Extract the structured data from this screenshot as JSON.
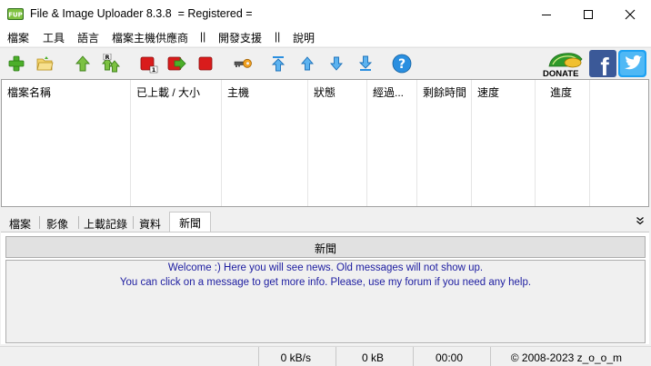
{
  "window": {
    "title": "File & Image Uploader 8.3.8  = Registered ="
  },
  "menu": {
    "items": [
      "檔案",
      "工具",
      "語言",
      "檔案主機供應商",
      "||",
      "開發支援",
      "||",
      "說明"
    ]
  },
  "toolbar": {
    "buttons": [
      "add-icon",
      "open-folder-icon",
      "upload-icon",
      "resume-upload-icon",
      "stop-icon",
      "transfer-icon",
      "stop-all-icon",
      "key-icon",
      "move-top-icon",
      "move-up-icon",
      "move-down-icon",
      "move-bottom-icon",
      "help-icon"
    ],
    "donate_label": "DONATE"
  },
  "list": {
    "columns": [
      "檔案名稱",
      "已上載 / 大小",
      "主機",
      "狀態",
      "經過...",
      "剩餘時間",
      "速度",
      "進度"
    ]
  },
  "tabs": {
    "items": [
      "檔案",
      "影像",
      "上載記錄",
      "資料",
      "新聞"
    ],
    "active_index": 4
  },
  "news": {
    "header": "新聞",
    "lines": [
      "Welcome :) Here you will see news. Old messages will not show up.",
      "You can click on a message to get more info. Please, use my forum if you need any help."
    ],
    "text_color": "#1c1ca0"
  },
  "status": {
    "speed": "0 kB/s",
    "size": "0 kB",
    "time": "00:00",
    "copyright": "© 2008-2023 z_o_o_m"
  },
  "colors": {
    "green": "#4caf2a",
    "red": "#d91c1c",
    "blue": "#2a8fe0",
    "facebook": "#3b5998",
    "twitter": "#1da1f2"
  }
}
